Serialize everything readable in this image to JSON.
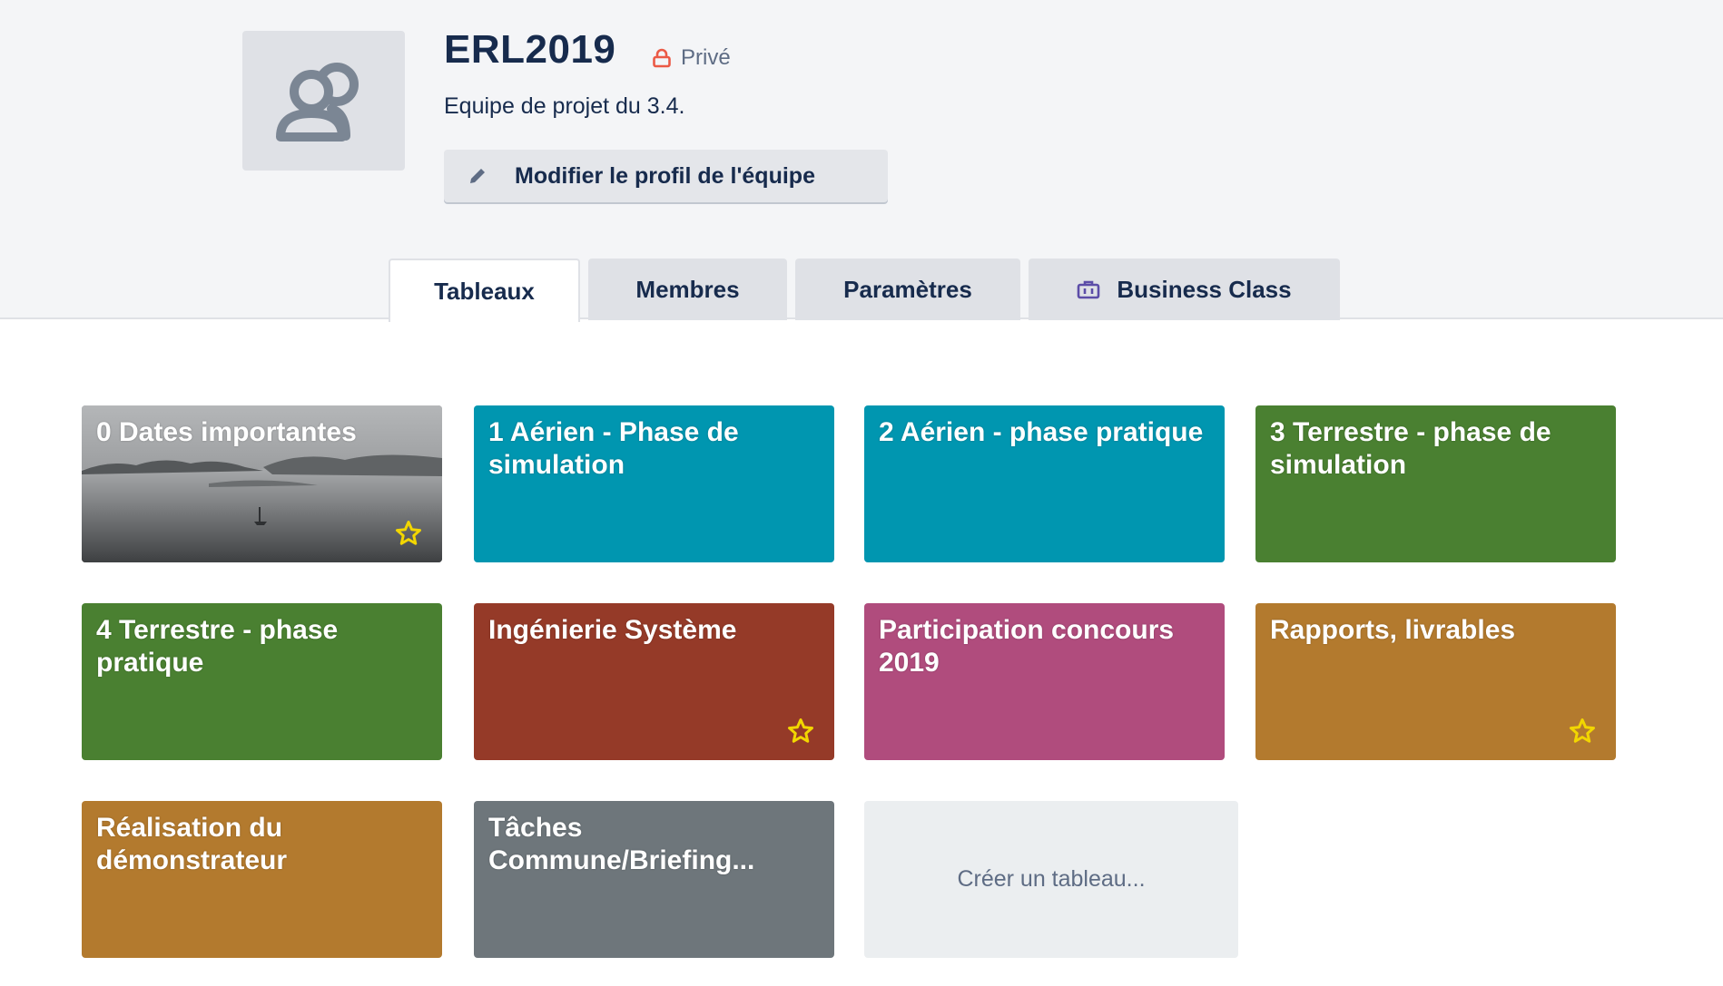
{
  "team": {
    "name": "ERL2019",
    "privacy_label": "Privé",
    "description": "Equipe de projet du 3.4.",
    "edit_label": "Modifier le profil de l'équipe"
  },
  "tabs": [
    {
      "label": "Tableaux",
      "active": true
    },
    {
      "label": "Membres",
      "active": false
    },
    {
      "label": "Paramètres",
      "active": false
    },
    {
      "label": "Business Class",
      "active": false,
      "icon": "briefcase-icon"
    }
  ],
  "boards": [
    {
      "title": "0 Dates importantes",
      "color": "#8a8d90",
      "background": "photo",
      "starred": true
    },
    {
      "title": "1 Aérien - Phase de simulation",
      "color": "#0096b0",
      "starred": false
    },
    {
      "title": "2 Aérien - phase pratique",
      "color": "#0096b0",
      "starred": false
    },
    {
      "title": "3 Terrestre - phase de simulation",
      "color": "#4a8031",
      "starred": false
    },
    {
      "title": "4 Terrestre - phase pratique",
      "color": "#4a8031",
      "starred": false
    },
    {
      "title": "Ingénierie Système",
      "color": "#953a28",
      "starred": true
    },
    {
      "title": "Participation concours 2019",
      "color": "#b04c7d",
      "starred": false
    },
    {
      "title": "Rapports, livrables",
      "color": "#b37a2e",
      "starred": true
    },
    {
      "title": "Réalisation du démonstrateur",
      "color": "#b37a2e",
      "starred": false
    },
    {
      "title": "Tâches Commune/Briefing...",
      "color": "#6e767b",
      "starred": false
    }
  ],
  "create_board_label": "Créer un tableau...",
  "colors": {
    "star": "#f2d600",
    "lock": "#eb5a46",
    "business_icon": "#5c4da8"
  }
}
